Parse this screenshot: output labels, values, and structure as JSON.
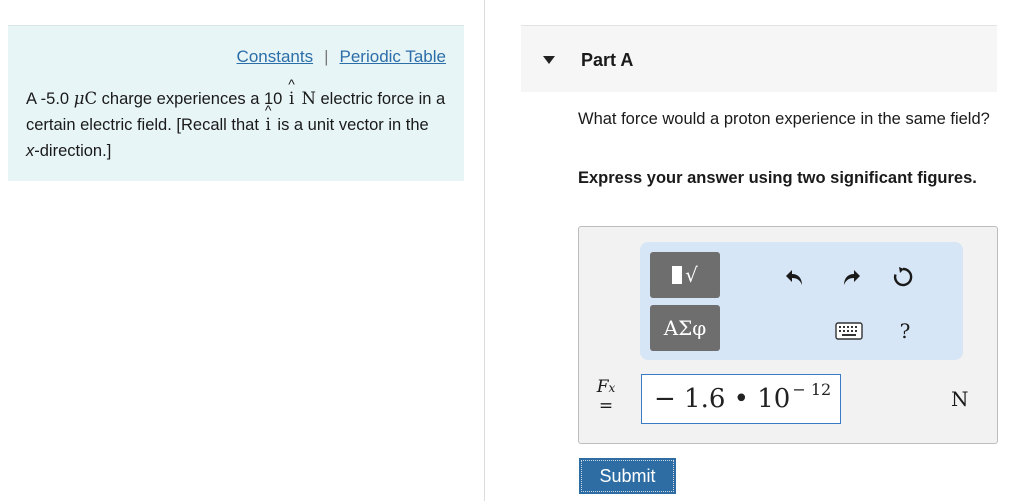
{
  "info": {
    "links": {
      "constants": "Constants",
      "separator": "|",
      "periodic_table": "Periodic Table"
    },
    "problem": {
      "p1": "A -5.0 ",
      "mu": "μ",
      "unit_c": "C",
      "p2": " charge experiences a 10 ",
      "vec": "i",
      "unit_n": " N",
      "p3": " electric force in a certain electric field. [Recall that ",
      "vec2": "i",
      "p4": " is a unit vector in the ",
      "xdir": "x",
      "p5": "-direction.]"
    }
  },
  "part": {
    "title": "Part A",
    "question": "What force would a proton experience in the same field?",
    "instruction": "Express your answer using two significant figures."
  },
  "toolbar": {
    "templates_glyph": "√",
    "symbols_label": "ΑΣφ",
    "undo_icon": "undo-icon",
    "redo_icon": "redo-icon",
    "reset_icon": "reset-icon",
    "keyboard_icon": "keyboard-icon",
    "help_label": "?"
  },
  "answer": {
    "var_name": "F",
    "var_sub": "x",
    "equals": "=",
    "mantissa": "− 1.6 • 10",
    "exponent": "− 12",
    "unit": "N"
  },
  "submit_label": "Submit",
  "colors": {
    "accent": "#2e6da4",
    "info_bg": "#e8f5f7",
    "toolbar_bg": "#d7e6f6",
    "link": "#2c6ea8"
  }
}
